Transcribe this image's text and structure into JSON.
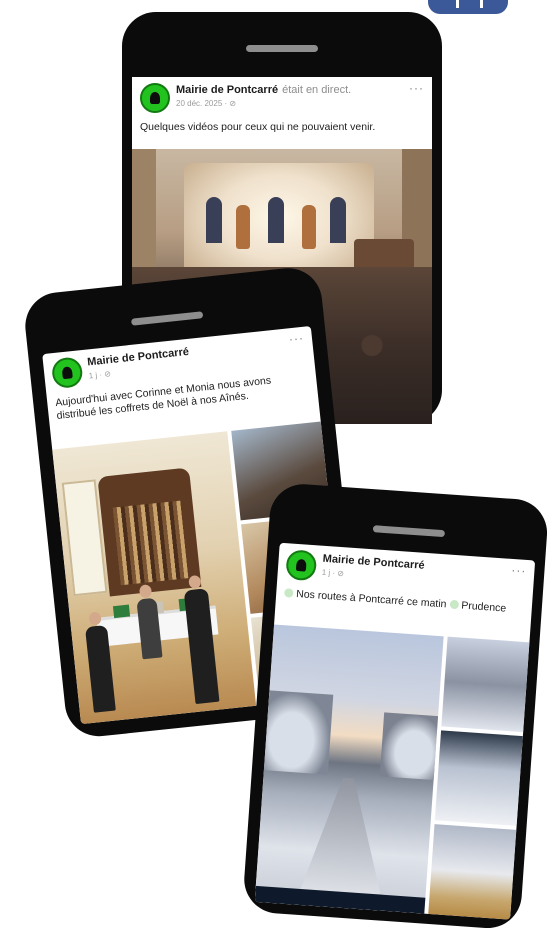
{
  "posts": [
    {
      "page_name": "Mairie de Pontcarré",
      "live_text": "était en direct.",
      "meta": "20 déc. 2025 · ",
      "text": "Quelques vidéos pour ceux qui ne pouvaient venir."
    },
    {
      "page_name": "Mairie de Pontcarré",
      "meta": "1 j · ",
      "text": "Aujourd'hui avec Corinne et Monia nous avons distribué les coffrets de Noël à nos Aînés."
    },
    {
      "page_name": "Mairie de Pontcarré",
      "meta": "1 j · ",
      "text": "Nos routes à Pontcarré ce matin",
      "text_suffix": "Prudence"
    }
  ],
  "icons": {
    "more": "···",
    "globe": "⊘"
  },
  "colors": {
    "facebook_blue": "#3b5998",
    "avatar_green": "#22c21f"
  }
}
